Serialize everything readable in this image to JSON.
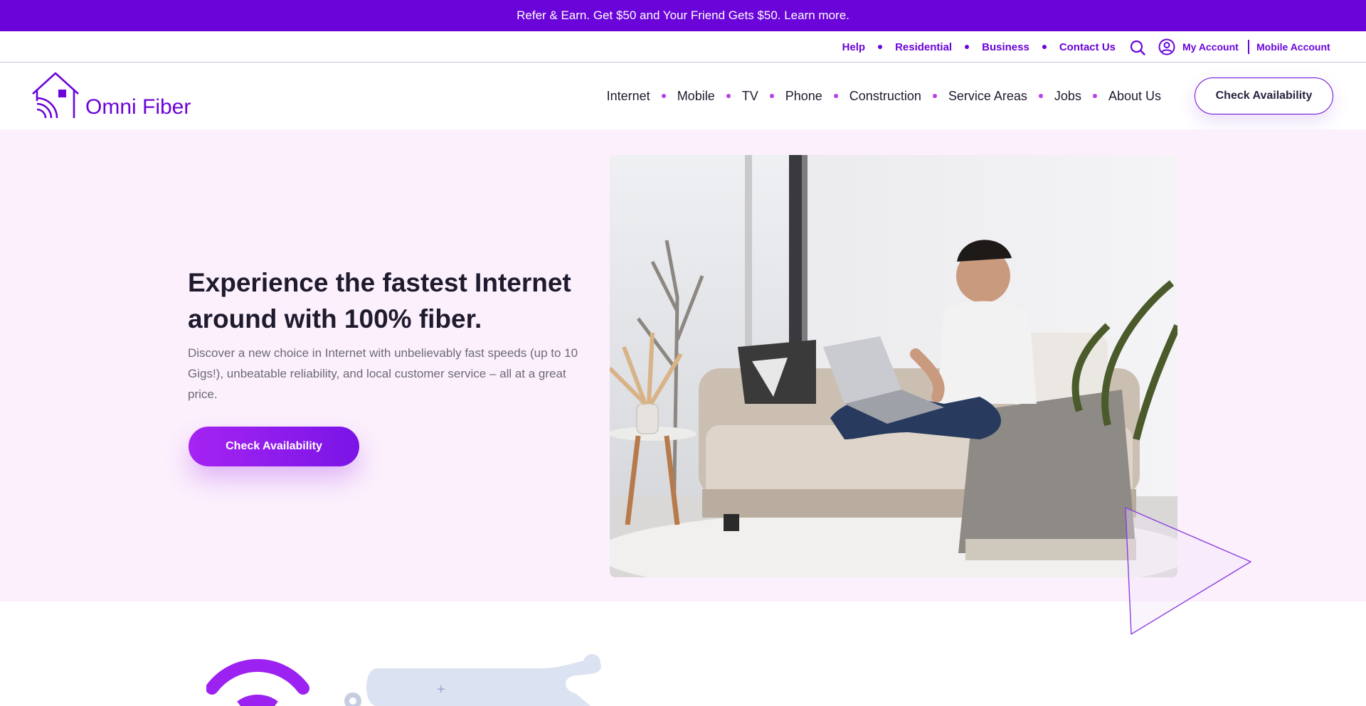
{
  "promo": {
    "text": "Refer & Earn. Get $50 and Your Friend Gets $50. Learn more."
  },
  "utility": {
    "links": [
      "Help",
      "Residential",
      "Business",
      "Contact Us"
    ],
    "my_account": "My Account",
    "mobile_account": "Mobile Account"
  },
  "brand": {
    "name": "Omni Fiber"
  },
  "nav": {
    "items": [
      "Internet",
      "Mobile",
      "TV",
      "Phone",
      "Construction",
      "Service Areas",
      "Jobs",
      "About Us"
    ],
    "cta": "Check Availability"
  },
  "hero": {
    "title": "Experience the fastest Internet around with 100% fiber.",
    "description": "Discover a new choice in Internet with unbelievably fast speeds (up to 10 Gigs!), unbeatable reliability, and local customer service – all at a great price.",
    "cta": "Check Availability"
  },
  "colors": {
    "brand_purple": "#6a04d9",
    "hero_bg": "#fcf0fc",
    "cta_gradient_start": "#a524f2",
    "cta_gradient_end": "#7a14e6",
    "nav_dot": "#b93ee6"
  },
  "icons": [
    "search-icon",
    "user-circle-icon",
    "house-wifi-logo-icon",
    "wifi-icon",
    "gear-icon"
  ]
}
